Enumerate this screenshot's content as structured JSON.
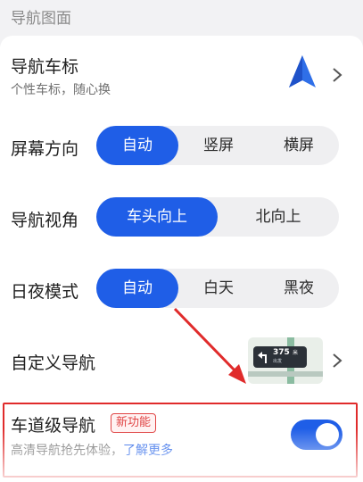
{
  "section_header": "导航图面",
  "vehicle_icon": {
    "title": "导航车标",
    "subtitle": "个性车标，随心换",
    "preview_icon": "navigation-arrow-icon",
    "chevron_icon": "chevron-right-icon"
  },
  "screen_orientation": {
    "label": "屏幕方向",
    "options": [
      "自动",
      "竖屏",
      "横屏"
    ],
    "selected": "自动"
  },
  "nav_view": {
    "label": "导航视角",
    "options": [
      "车头向上",
      "北向上"
    ],
    "selected": "车头向上"
  },
  "day_night": {
    "label": "日夜模式",
    "options": [
      "自动",
      "白天",
      "黑夜"
    ],
    "selected": "自动"
  },
  "custom_nav": {
    "label": "自定义导航",
    "preview": {
      "distance": "375",
      "unit": "米",
      "street": "出发"
    },
    "chevron_icon": "chevron-right-icon"
  },
  "lane_nav": {
    "label": "车道级导航",
    "badge": "新功能",
    "subtitle": "高清导航抢先体验，",
    "link": "了解更多",
    "toggle_on": true
  },
  "colors": {
    "accent": "#1f5ee7",
    "annotation_red": "#e02b2b",
    "badge_red": "#e04545"
  }
}
